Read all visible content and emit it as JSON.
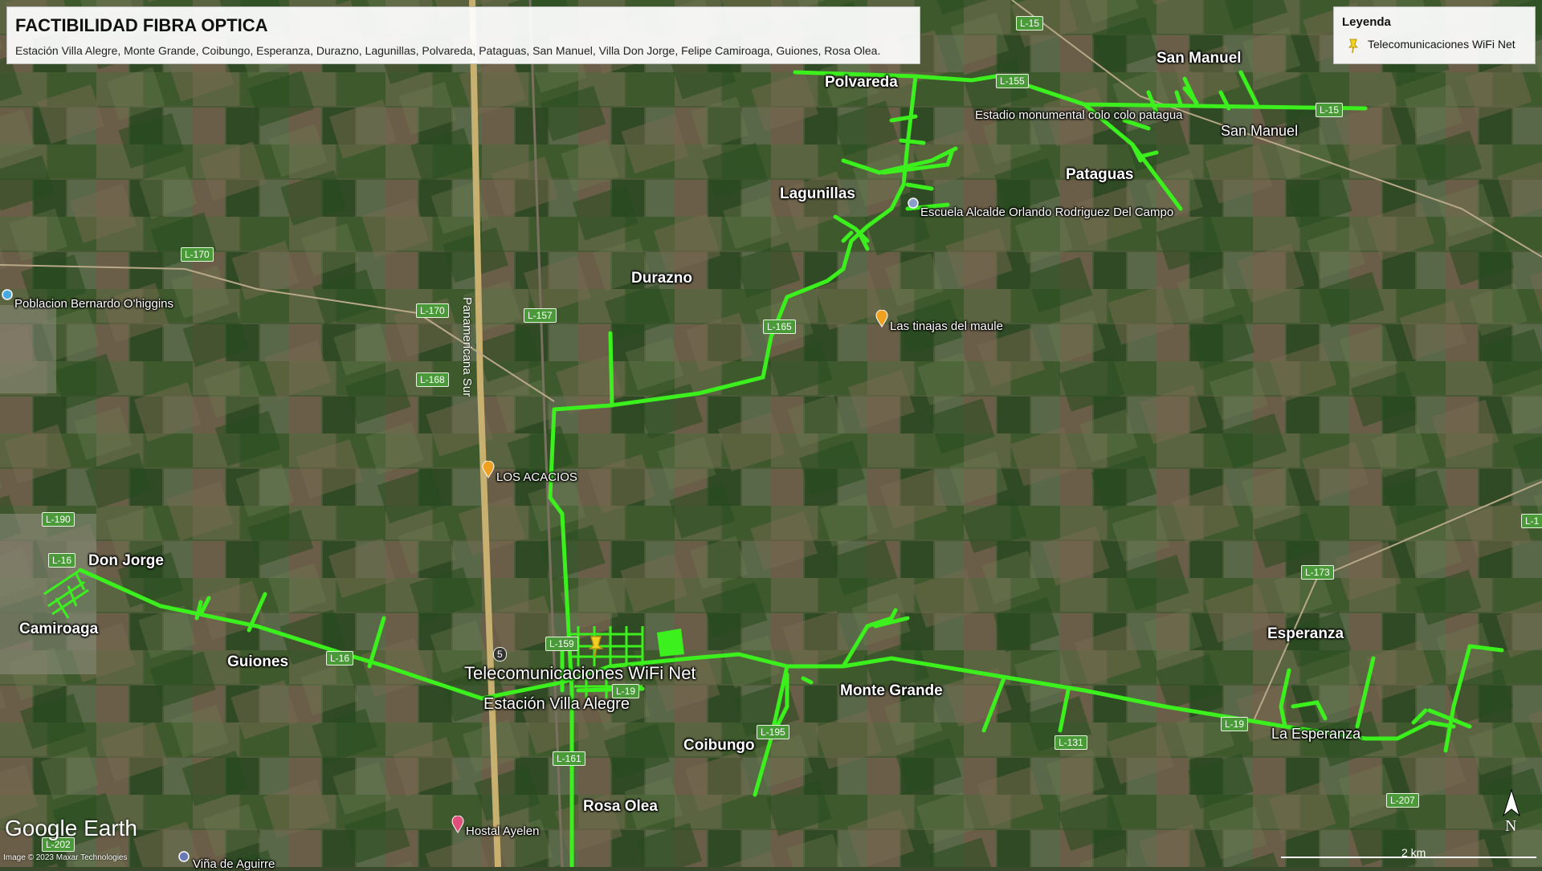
{
  "title": {
    "main": "FACTIBILIDAD FIBRA OPTICA",
    "subtitle": "Estación Villa Alegre, Monte Grande, Coibungo, Esperanza, Durazno, Lagunillas, Polvareda, Pataguas, San Manuel, Villa Don Jorge, Felipe Camiroaga, Guiones, Rosa Olea."
  },
  "legend": {
    "heading": "Leyenda",
    "item": "Telecomunicaciones WiFi Net",
    "pin_color": "#f5d020"
  },
  "towns": {
    "polvareda": "Polvareda",
    "san_manuel": "San Manuel",
    "pataguas": "Pataguas",
    "lagunillas": "Lagunillas",
    "durazno": "Durazno",
    "don_jorge": "Don Jorge",
    "camiroaga": "Camiroaga",
    "guiones": "Guiones",
    "monte_grande": "Monte Grande",
    "coibungo": "Coibungo",
    "rosa_olea": "Rosa Olea",
    "esperanza": "Esperanza"
  },
  "places": {
    "estadio": "Estadio monumental colo colo patagua",
    "san_manuel_place": "San Manuel",
    "escuela": "Escuela Alcalde Orlando Rodriguez Del Campo",
    "tinajas": "Las tinajas del maule",
    "poblacion": "Poblacion Bernardo O'higgins",
    "acacios": "LOS ACACIOS",
    "hostal": "Hostal Ayelen",
    "vina": "Viña de Aguirre",
    "la_esperanza": "La Esperanza",
    "telecom": "Telecomunicaciones WiFi Net",
    "estacion": "Estación Villa Alegre",
    "panamericana": "Panamericana Sur"
  },
  "roads": {
    "l15a": "L-15",
    "l155": "L-155",
    "l15b": "L-15",
    "l170a": "L-170",
    "l170b": "L-170",
    "l157": "L-157",
    "l165": "L-165",
    "l168": "L-168",
    "l190": "L-190",
    "l16a": "L-16",
    "l16b": "L-16",
    "l159": "L-159",
    "l19a": "L-19",
    "l19b": "L-19",
    "l195": "L-195",
    "l161": "L-161",
    "l131": "L-131",
    "l173": "L-173",
    "l207": "L-207",
    "l202": "L-202",
    "l1": "L-1",
    "r5": "5"
  },
  "map": {
    "fiber_color": "#3cf01e",
    "scale_label": "2 km",
    "north_label": "N",
    "logo": "Google Earth",
    "credit": "Image © 2023 Maxar Technologies"
  }
}
